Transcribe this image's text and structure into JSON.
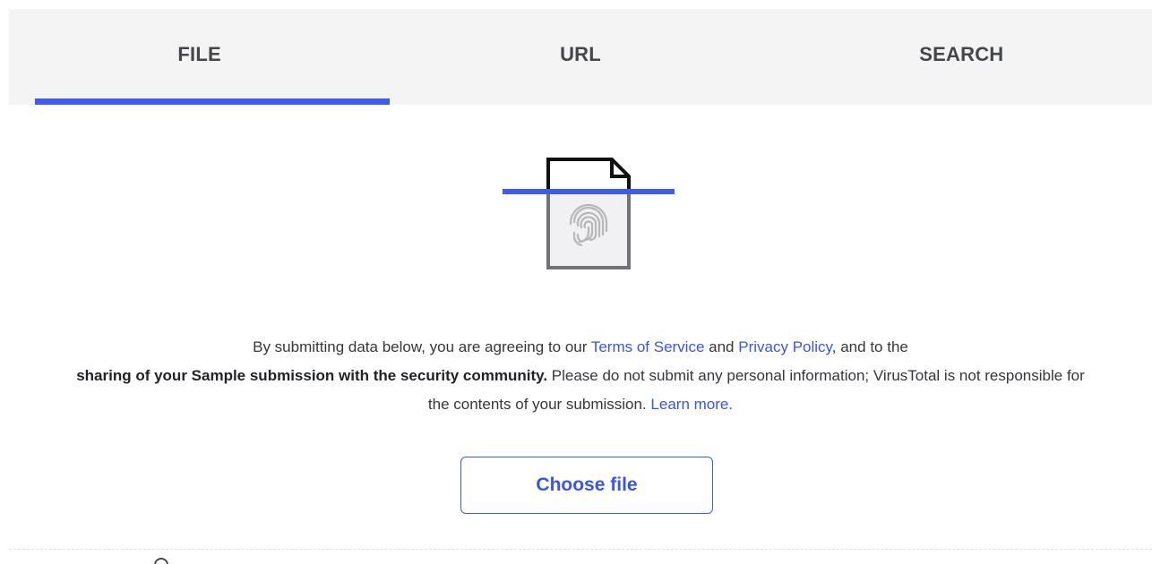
{
  "tabs": [
    {
      "id": "file",
      "label": "FILE",
      "active": true
    },
    {
      "id": "url",
      "label": "URL",
      "active": false
    },
    {
      "id": "search",
      "label": "SEARCH",
      "active": false
    }
  ],
  "hero": {
    "icon": "file-fingerprint-scan-icon"
  },
  "agreement": {
    "prefix": "By submitting data below, you are agreeing to our ",
    "terms_link": "Terms of Service",
    "and_text": " and ",
    "privacy_link": "Privacy Policy",
    "after_privacy": ", and to the ",
    "sharing_bold": "sharing of your Sample submission with the security community.",
    "disclaimer": " Please do not submit any personal information; VirusTotal is not responsible for the contents of your submission. ",
    "learn_more_link": "Learn more."
  },
  "choose_file": {
    "label": "Choose file"
  },
  "colors": {
    "accent": "#3f5bef",
    "link": "#3a55e6",
    "tab_bar_bg": "#f4f4f4",
    "text": "#36373a"
  }
}
